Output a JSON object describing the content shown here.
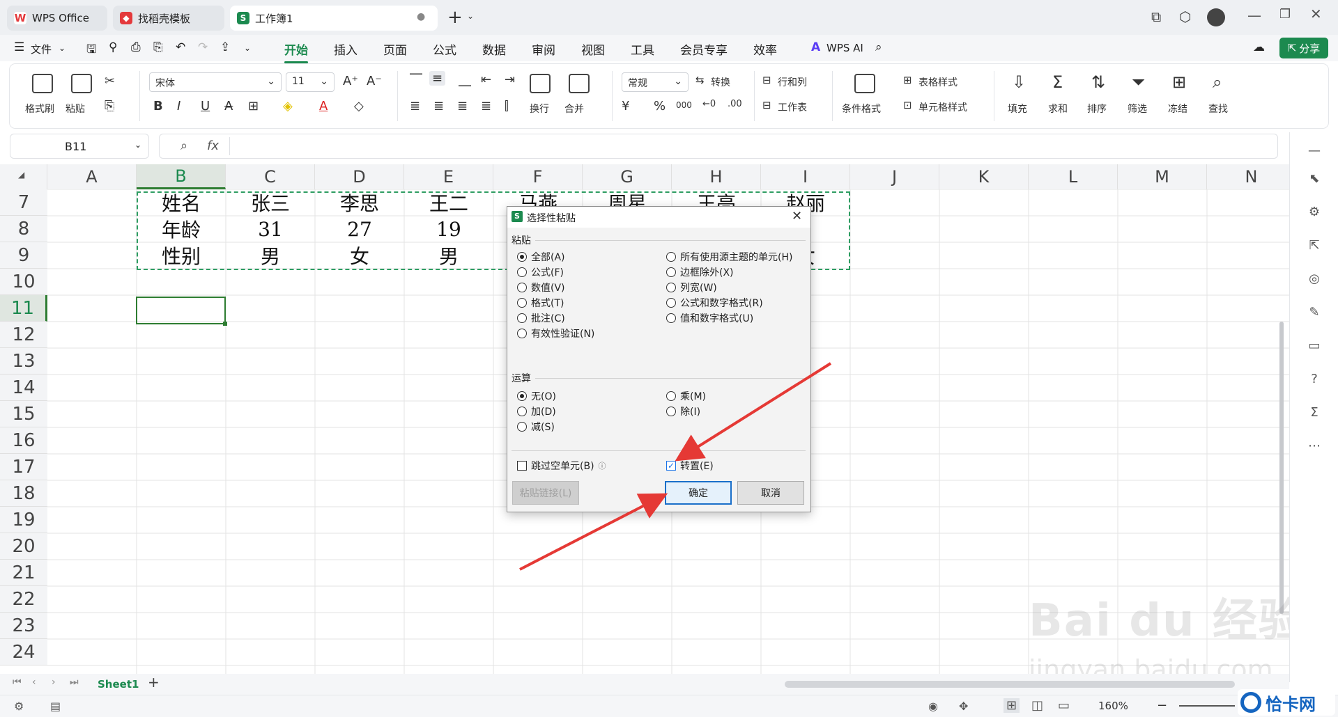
{
  "tabs": [
    {
      "label": "WPS Office",
      "icon": "wps-logo-icon"
    },
    {
      "label": "找稻壳模板",
      "icon": "docer-icon"
    },
    {
      "label": "工作簿1",
      "icon": "sheet-s-icon"
    }
  ],
  "menu": {
    "file": "文件",
    "items": [
      "开始",
      "插入",
      "页面",
      "公式",
      "数据",
      "审阅",
      "视图",
      "工具",
      "会员专享",
      "效率"
    ],
    "active": "开始",
    "wps_ai": "WPS AI",
    "share": "分享"
  },
  "ribbon": {
    "format_painter": "格式刷",
    "paste": "粘贴",
    "font_name": "宋体",
    "font_size": "11",
    "bold": "B",
    "italic": "I",
    "underline": "U",
    "strike": "A",
    "wrap": "换行",
    "merge": "合并",
    "number_format": "常规",
    "convert": "转换",
    "row_col": "行和列",
    "worksheet": "工作表",
    "cond_format": "条件格式",
    "table_style": "表格样式",
    "cell_style": "单元格样式",
    "fill": "填充",
    "sum": "求和",
    "sort": "排序",
    "filter": "筛选",
    "freeze": "冻结",
    "find": "查找",
    "yen": "¥",
    "percent": "%",
    "thousands": "000"
  },
  "formula_bar": {
    "name_box": "B11",
    "fx": "fx",
    "value": ""
  },
  "grid": {
    "columns": [
      "A",
      "B",
      "C",
      "D",
      "E",
      "F",
      "G",
      "H",
      "I",
      "J",
      "K",
      "L",
      "M",
      "N"
    ],
    "rows": [
      "7",
      "8",
      "9",
      "10",
      "11",
      "12",
      "13",
      "14",
      "15",
      "16",
      "17",
      "18",
      "19",
      "20",
      "21",
      "22",
      "23",
      "24"
    ],
    "data": [
      [
        "姓名",
        "张三",
        "李思",
        "王二",
        "马燕",
        "周星",
        "王亮",
        "赵丽"
      ],
      [
        "年龄",
        "31",
        "27",
        "19",
        "",
        "",
        "",
        "3"
      ],
      [
        "性别",
        "男",
        "女",
        "男",
        "",
        "",
        "",
        "女"
      ]
    ],
    "selected_cell": "B11"
  },
  "dialog": {
    "title": "选择性粘贴",
    "paste_section": "粘贴",
    "paste_options_left": [
      "全部(A)",
      "公式(F)",
      "数值(V)",
      "格式(T)",
      "批注(C)",
      "有效性验证(N)"
    ],
    "paste_options_right": [
      "所有使用源主题的单元(H)",
      "边框除外(X)",
      "列宽(W)",
      "公式和数字格式(R)",
      "值和数字格式(U)"
    ],
    "paste_selected": "全部(A)",
    "operation_section": "运算",
    "operation_left": [
      "无(O)",
      "加(D)",
      "减(S)"
    ],
    "operation_right": [
      "乘(M)",
      "除(I)"
    ],
    "operation_selected": "无(O)",
    "skip_blanks": "跳过空单元(B)",
    "skip_blanks_checked": false,
    "transpose": "转置(E)",
    "transpose_checked": true,
    "paste_link": "粘贴链接(L)",
    "ok": "确定",
    "cancel": "取消"
  },
  "sheet_bar": {
    "sheet_name": "Sheet1",
    "add": "+"
  },
  "status_bar": {
    "zoom": "160%"
  },
  "watermark": {
    "text1": "Bai du 经验",
    "text2": "jingyan.baidu.com",
    "corner": "恰卡网"
  },
  "colors": {
    "accent": "#1c8a4f",
    "arrow": "#e53935",
    "selection": "#2e7d32"
  }
}
